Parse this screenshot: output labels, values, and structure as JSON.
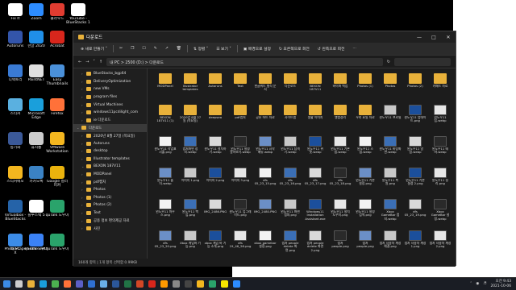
{
  "desktop_icons": [
    {
      "label": "Fix It",
      "icon": "app-icon",
      "color": "#ffffff"
    },
    {
      "label": "Zoom",
      "icon": "zoom-icon",
      "color": "#2d8cff"
    },
    {
      "label": "클라우드",
      "icon": "app-icon",
      "color": "#e03c31"
    },
    {
      "label": "YouTube - BlueStacks 1",
      "icon": "youtube-icon",
      "color": "#ffffff"
    },
    {
      "label": "Autoruns",
      "icon": "app-icon",
      "color": "#3355aa"
    },
    {
      "label": "한글 2020",
      "icon": "hwp-icon",
      "color": "#1f8fe8"
    },
    {
      "label": "Acrobat",
      "icon": "acrobat-icon",
      "color": "#d8261c"
    },
    {
      "label": "디렉토리",
      "icon": "app-icon",
      "color": "#3a7bd5"
    },
    {
      "label": "PaintNET",
      "icon": "paint-icon",
      "color": "#e0e0e0"
    },
    {
      "label": "Easy Thumbnails",
      "icon": "app-icon",
      "color": "#4a90d9"
    },
    {
      "label": "스티커",
      "icon": "app-icon",
      "color": "#5ab0e0"
    },
    {
      "label": "Microsoft Edge",
      "icon": "edge-icon",
      "color": "#1a9fdb"
    },
    {
      "label": "Firefox",
      "icon": "firefox-icon",
      "color": "#ff7139"
    },
    {
      "label": "동기화",
      "icon": "app-icon",
      "color": "#3b5998"
    },
    {
      "label": "휴지통",
      "icon": "recycle-bin-icon",
      "color": "#cccccc"
    },
    {
      "label": "VMware Workstation",
      "icon": "vmware-icon",
      "color": "#f3b61f"
    },
    {
      "label": "스티커메모",
      "icon": "app-icon",
      "color": "#f3b61f"
    },
    {
      "label": "카카오톡",
      "icon": "app-icon",
      "color": "#3b82c4"
    },
    {
      "label": "Google 컬러피커",
      "icon": "app-icon",
      "color": "#e9b20d"
    },
    {
      "label": "Virtualbox - BlueStacks",
      "icon": "app-icon",
      "color": "#2563a8"
    },
    {
      "label": "블루스택 5",
      "icon": "app-icon",
      "color": "#ffffff"
    },
    {
      "label": "quTalk 도우미",
      "icon": "app-icon",
      "color": "#2aa36b"
    },
    {
      "label": "PhotoScape X",
      "icon": "app-icon",
      "color": "#6b6b6b"
    },
    {
      "label": "quTalk 도우미",
      "icon": "app-icon",
      "color": "#2aa36b"
    },
    {
      "label": "quTalk 도우미",
      "icon": "app-icon",
      "color": "#2aa36b"
    },
    {
      "label": "내 PC",
      "icon": "this-pc-icon",
      "color": "#3c8ce7"
    },
    {
      "label": "Sothe net",
      "icon": "app-icon",
      "color": "#3b82f6"
    }
  ],
  "explorer": {
    "title": "다운로드",
    "command_bar": {
      "new": "새로 만들기",
      "sort": "정렬",
      "view": "보기",
      "set_background": "배경으로 설정",
      "rotate_right": "오른쪽으로 회전",
      "rotate_left": "왼쪽으로 회전"
    },
    "address": "내 PC  >  2500 (D:)  >  다운로드",
    "nav_items": [
      "BlueStacks_bgp64",
      "DeliveryOptimization",
      "new VMs",
      "program files",
      "Virtual Machines",
      "windows11pcdilight_com",
      "ie 다운로드",
      "다운로드",
      "2020년 8월 27일 (목요일)",
      "Autoruns",
      "desktop",
      "Illustrator templates",
      "BEXON 187V11",
      "MODPanel",
      "pdf캡처",
      "Photos",
      "Photos (1)",
      "Photos (2)",
      "Text",
      "공용 정보 편의제공 자료",
      "사진"
    ],
    "files": [
      {
        "name": "MODPanel",
        "kind": "folder"
      },
      {
        "name": "Illustrator templates",
        "kind": "folder"
      },
      {
        "name": "Autoruns",
        "kind": "folder"
      },
      {
        "name": "Text",
        "kind": "folder"
      },
      {
        "name": "한글워드 형식 문서",
        "kind": "folder"
      },
      {
        "name": "다운로드",
        "kind": "folder"
      },
      {
        "name": "BEXON 187V11",
        "kind": "folder"
      },
      {
        "name": "바이퍼 백업",
        "kind": "folder"
      },
      {
        "name": "Photos (1)",
        "kind": "folder"
      },
      {
        "name": "Photos",
        "kind": "folder"
      },
      {
        "name": "Photos (2)",
        "kind": "folder"
      },
      {
        "name": "키패드 자료",
        "kind": "folder"
      },
      {
        "name": "BEXON 187V11 (1)",
        "kind": "folder"
      },
      {
        "name": "2020년 8월 27일 (목요일)",
        "kind": "folder"
      },
      {
        "name": "deepsea",
        "kind": "folder"
      },
      {
        "name": "pdf캡처",
        "kind": "folder"
      },
      {
        "name": "공유 하드 자료",
        "kind": "folder"
      },
      {
        "name": "사이트맵",
        "kind": "folder"
      },
      {
        "name": "생활 이미지",
        "kind": "folder"
      },
      {
        "name": "앨범정리",
        "kind": "folder"
      },
      {
        "name": "우리 요일 자료",
        "kind": "folder"
      },
      {
        "name": "윈도우11 프로필",
        "kind": "image"
      },
      {
        "name": "윈도우11 업데이트.png",
        "kind": "image"
      },
      {
        "name": "윈도우11 팁.webp",
        "kind": "image"
      },
      {
        "name": "윈도우11 작업표시줄.png",
        "kind": "image"
      },
      {
        "name": "캡처화면 정리.webp",
        "kind": "image"
      },
      {
        "name": "윈도우11 설치하기.webp",
        "kind": "image"
      },
      {
        "name": "윈도우11 설정 알아보기.webp",
        "kind": "image"
      },
      {
        "name": "윈도우11 시작 메뉴.webp",
        "kind": "image"
      },
      {
        "name": "윈도우11 탐색기.webp",
        "kind": "image"
      },
      {
        "name": "윈도우11 위젯.webp",
        "kind": "image"
      },
      {
        "name": "윈도우11 기본앱.webp",
        "kind": "image"
      },
      {
        "name": "윈도우11 스냅.webp",
        "kind": "image"
      },
      {
        "name": "윈도우11 바탕화면.webp",
        "kind": "image"
      },
      {
        "name": "윈도우11 알림.webp",
        "kind": "image"
      },
      {
        "name": "윈도우11 테마.webp",
        "kind": "image"
      },
      {
        "name": "윈도우11 폴더.webp",
        "kind": "image"
      },
      {
        "name": "이미지 1.png",
        "kind": "image"
      },
      {
        "name": "이미지 2.png",
        "kind": "image"
      },
      {
        "name": "이미지 3.png",
        "kind": "image"
      },
      {
        "name": "dfs 05_23_15.png",
        "kind": "image"
      },
      {
        "name": "dfs 05_23_16.png",
        "kind": "image"
      },
      {
        "name": "dfs 05_23_17.png",
        "kind": "image"
      },
      {
        "name": "dfs 05_23_18.png",
        "kind": "image"
      },
      {
        "name": "윈도우11 기본 설정.png",
        "kind": "image"
      },
      {
        "name": "윈도우11 복원.png",
        "kind": "image"
      },
      {
        "name": "윈도우11 기본 설정 2.png",
        "kind": "image"
      },
      {
        "name": "윈도우11 정리.png",
        "kind": "image"
      },
      {
        "name": "윈도우11 마우스.png",
        "kind": "image"
      },
      {
        "name": "윈도우11 백업.png",
        "kind": "image"
      },
      {
        "name": "IMG_2486.PNG",
        "kind": "image"
      },
      {
        "name": "윈도우11 업그레이드.png",
        "kind": "image"
      },
      {
        "name": "IMG_2480.PNG",
        "kind": "image"
      },
      {
        "name": "윈도우11 화면 캡처.png",
        "kind": "image"
      },
      {
        "name": "Windows11 Installation Assistant.exe",
        "kind": "image"
      },
      {
        "name": "윈도우11 설치 도우미.png",
        "kind": "image"
      },
      {
        "name": "윈도우11 설정 검색.png",
        "kind": "image"
      },
      {
        "name": "Xbox GameBar 캡처.webp",
        "kind": "image"
      },
      {
        "name": "dfs 05_23_19.png",
        "kind": "image"
      },
      {
        "name": "Xbox GameBar 설정.webp",
        "kind": "image"
      },
      {
        "name": "dfs 05_23_20.png",
        "kind": "image"
      },
      {
        "name": "Xbox 게임바 기능.png",
        "kind": "image"
      },
      {
        "name": "xbox 게임 바 기능 소개.png",
        "kind": "image"
      },
      {
        "name": "dfs 19_46_56.png",
        "kind": "image"
      },
      {
        "name": "xbox gamebar 설정.png",
        "kind": "image"
      },
      {
        "name": "캡처 people delete 화면.png",
        "kind": "image"
      },
      {
        "name": "캡처 people delete 화면 2.png",
        "kind": "image"
      },
      {
        "name": "캡처 people.png",
        "kind": "image"
      },
      {
        "name": "캡처 people.png",
        "kind": "image"
      },
      {
        "name": "캡처 사용자 계정 해결.png",
        "kind": "image"
      },
      {
        "name": "캡처 사용자 계정 1.png",
        "kind": "image"
      },
      {
        "name": "캡처 사용자 계정 2.png",
        "kind": "image"
      },
      {
        "name": "캡처 사용자 계정 3.png",
        "kind": "image"
      },
      {
        "name": "캡처 사용자 계정 4.png",
        "kind": "image"
      },
      {
        "name": "캡처 사용자 계정 5.png",
        "kind": "image"
      },
      {
        "name": "캡처 사용자 계정 6.png",
        "kind": "image"
      }
    ],
    "status": "160개 항목  |  1개 항목 선택함 0.99KB"
  },
  "taskbar": {
    "apps": [
      "windows",
      "search",
      "files",
      "edge",
      "chrome",
      "firefox",
      "store",
      "mail",
      "photos",
      "word",
      "excel",
      "powerpoint",
      "acrobat",
      "illustrator",
      "settings",
      "terminal",
      "vmware",
      "bluestacks",
      "kakao",
      "zoom"
    ],
    "time": "오전 9:43",
    "date": "2021-10-06"
  }
}
